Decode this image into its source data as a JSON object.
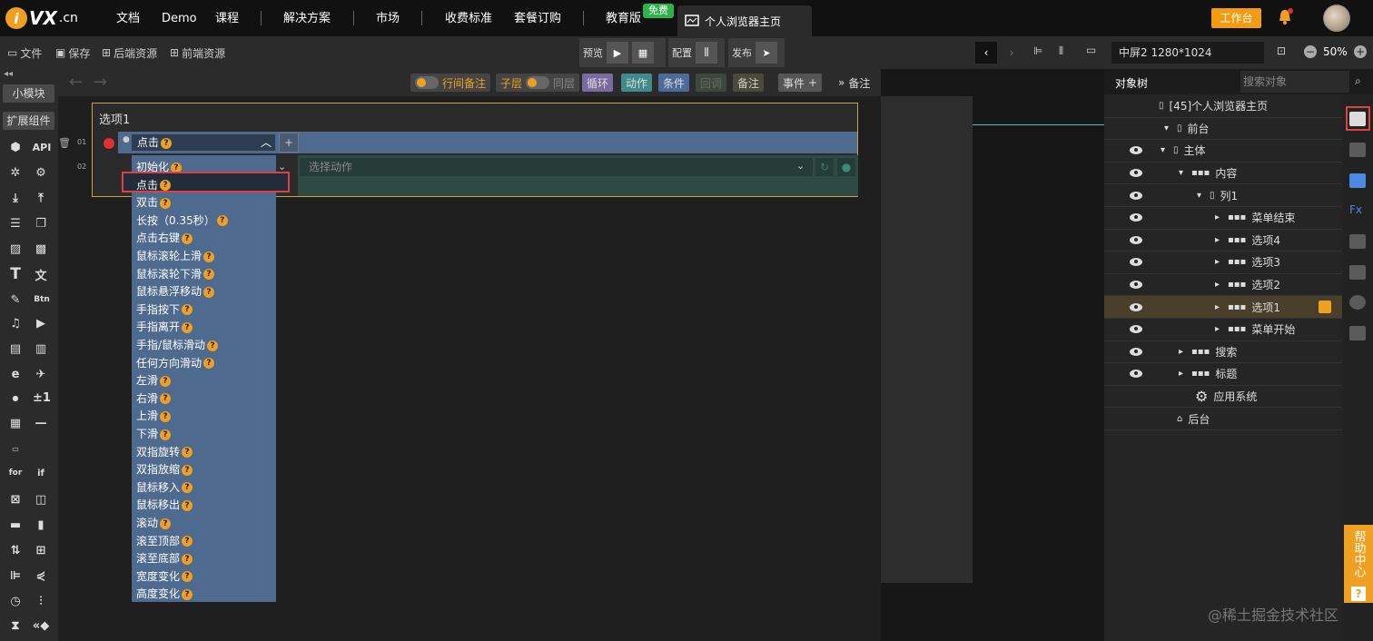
{
  "topbar": {
    "logo_cn": ".cn",
    "logo_mark": "VX",
    "nav": [
      "文档",
      "Demo",
      "课程",
      "解决方案",
      "市场",
      "收费标准",
      "套餐订购",
      "教育版"
    ],
    "free_badge": "免费",
    "tab_title": "个人浏览器主页",
    "work_button": "工作台"
  },
  "toolbar": {
    "file": "文件",
    "save": "保存",
    "backend": "后端资源",
    "frontend": "前端资源",
    "preview": "预览",
    "config": "配置",
    "publish": "发布",
    "screen": "中屏2 1280*1024",
    "zoom": "50%"
  },
  "leftbar": {
    "small_module": "小模块",
    "ext_components": "扩展组件",
    "api_label": "API",
    "btn_label": "Btn",
    "plus_minus": "±1",
    "for_label": "for",
    "if_label": "if"
  },
  "editor_toolbar": {
    "line_note": "行间备注",
    "child_layer": "子层",
    "same_layer": "同层",
    "loop": "循环",
    "action": "动作",
    "condition": "条件",
    "callback": "回调",
    "note": "备注",
    "event": "事件",
    "note_right": "备注"
  },
  "panel": {
    "title": "选项1",
    "row1_num": "01",
    "row2_num": "02",
    "event_selected": "点击",
    "select_action_placeholder": "选择动作"
  },
  "dropdown": {
    "items": [
      "初始化",
      "点击",
      "双击",
      "长按（0.35秒）",
      "点击右键",
      "鼠标滚轮上滑",
      "鼠标滚轮下滑",
      "鼠标悬浮移动",
      "手指按下",
      "手指离开",
      "手指/鼠标滑动",
      "任何方向滑动",
      "左滑",
      "右滑",
      "上滑",
      "下滑",
      "双指旋转",
      "双指放缩",
      "鼠标移入",
      "鼠标移出",
      "滚动",
      "滚至顶部",
      "滚至底部",
      "宽度变化",
      "高度变化"
    ],
    "highlighted": "点击"
  },
  "right_panel": {
    "tab_tree": "对象树",
    "search_placeholder": "搜索对象",
    "tree": [
      {
        "label": "[45]个人浏览器主页",
        "indent": 0,
        "eye": false
      },
      {
        "label": "前台",
        "indent": 1,
        "eye": false
      },
      {
        "label": "主体",
        "indent": 2,
        "eye": true
      },
      {
        "label": "内容",
        "indent": 3,
        "eye": true
      },
      {
        "label": "列1",
        "indent": 4,
        "eye": true
      },
      {
        "label": "菜单结束",
        "indent": 5,
        "eye": true
      },
      {
        "label": "选项4",
        "indent": 5,
        "eye": true
      },
      {
        "label": "选项3",
        "indent": 5,
        "eye": true
      },
      {
        "label": "选项2",
        "indent": 5,
        "eye": true
      },
      {
        "label": "选项1",
        "indent": 5,
        "eye": true,
        "selected": true
      },
      {
        "label": "菜单开始",
        "indent": 5,
        "eye": true
      },
      {
        "label": "搜索",
        "indent": 3,
        "eye": true
      },
      {
        "label": "标题",
        "indent": 3,
        "eye": true
      },
      {
        "label": "应用系统",
        "indent": 2,
        "eye": false
      },
      {
        "label": "后台",
        "indent": 1,
        "eye": false
      }
    ]
  },
  "side_help": "帮助中心",
  "side_help_q": "?",
  "watermark": "@稀土掘金技术社区",
  "colors": {
    "accent": "#f0a020",
    "selected_row": "#4a3f2a",
    "option_row": "#4e6a8e",
    "highlight_border": "#e04040"
  }
}
